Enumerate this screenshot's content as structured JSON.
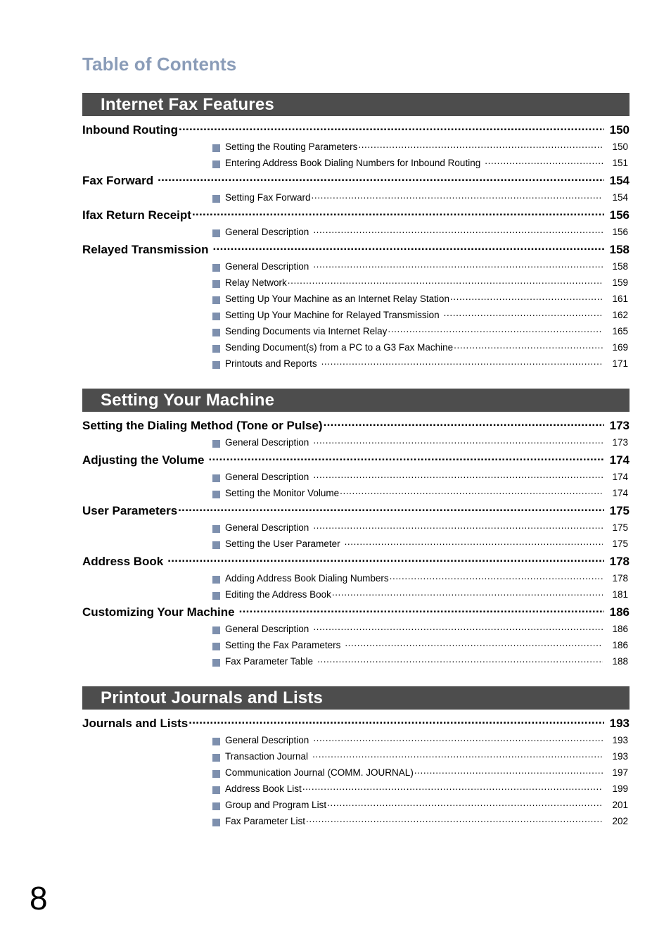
{
  "page": {
    "title": "Table of Contents",
    "folio": "8",
    "colors": {
      "title": "#8a9cb8",
      "banner_bg": "#4d4d4d",
      "banner_text": "#ffffff",
      "bullet": "#7e90ae",
      "text": "#000000",
      "background": "#ffffff"
    }
  },
  "sections": [
    {
      "banner": "Internet Fax Features",
      "entries": [
        {
          "level": 1,
          "label": "Inbound Routing",
          "page": "150",
          "space_before_leader": false
        },
        {
          "level": 2,
          "label": "Setting the Routing Parameters",
          "page": "150",
          "space_before_leader": false
        },
        {
          "level": 2,
          "label": "Entering Address Book Dialing Numbers for Inbound Routing",
          "page": "151",
          "space_before_leader": true
        },
        {
          "level": 1,
          "label": "Fax Forward",
          "page": "154",
          "space_before_leader": true
        },
        {
          "level": 2,
          "label": "Setting Fax Forward",
          "page": "154",
          "space_before_leader": false
        },
        {
          "level": 1,
          "label": "Ifax Return Receipt",
          "page": "156",
          "space_before_leader": false
        },
        {
          "level": 2,
          "label": "General Description",
          "page": "156",
          "space_before_leader": true
        },
        {
          "level": 1,
          "label": "Relayed Transmission",
          "page": "158",
          "space_before_leader": true
        },
        {
          "level": 2,
          "label": "General Description",
          "page": "158",
          "space_before_leader": true
        },
        {
          "level": 2,
          "label": "Relay Network",
          "page": "159",
          "space_before_leader": false
        },
        {
          "level": 2,
          "label": "Setting Up Your Machine as an Internet Relay Station",
          "page": "161",
          "space_before_leader": false
        },
        {
          "level": 2,
          "label": "Setting Up Your Machine for Relayed Transmission",
          "page": "162",
          "space_before_leader": true
        },
        {
          "level": 2,
          "label": "Sending Documents via Internet Relay",
          "page": "165",
          "space_before_leader": false
        },
        {
          "level": 2,
          "label": "Sending Document(s) from a PC to a G3 Fax Machine",
          "page": "169",
          "space_before_leader": false
        },
        {
          "level": 2,
          "label": "Printouts and Reports",
          "page": "171",
          "space_before_leader": true
        }
      ]
    },
    {
      "banner": "Setting Your Machine",
      "entries": [
        {
          "level": 1,
          "label": "Setting the Dialing Method (Tone or Pulse)",
          "page": "173",
          "space_before_leader": false
        },
        {
          "level": 2,
          "label": "General Description",
          "page": "173",
          "space_before_leader": true
        },
        {
          "level": 1,
          "label": "Adjusting the Volume",
          "page": "174",
          "space_before_leader": true
        },
        {
          "level": 2,
          "label": "General Description",
          "page": "174",
          "space_before_leader": true
        },
        {
          "level": 2,
          "label": "Setting the Monitor Volume",
          "page": "174",
          "space_before_leader": false
        },
        {
          "level": 1,
          "label": "User Parameters",
          "page": "175",
          "space_before_leader": false
        },
        {
          "level": 2,
          "label": "General Description",
          "page": "175",
          "space_before_leader": true
        },
        {
          "level": 2,
          "label": "Setting the User Parameter",
          "page": "175",
          "space_before_leader": true
        },
        {
          "level": 1,
          "label": "Address Book",
          "page": "178",
          "space_before_leader": true
        },
        {
          "level": 2,
          "label": "Adding Address Book Dialing Numbers",
          "page": "178",
          "space_before_leader": false
        },
        {
          "level": 2,
          "label": "Editing the Address Book",
          "page": "181",
          "space_before_leader": false
        },
        {
          "level": 1,
          "label": "Customizing Your Machine",
          "page": "186",
          "space_before_leader": true
        },
        {
          "level": 2,
          "label": "General Description",
          "page": "186",
          "space_before_leader": true
        },
        {
          "level": 2,
          "label": "Setting the Fax Parameters",
          "page": "186",
          "space_before_leader": true
        },
        {
          "level": 2,
          "label": "Fax Parameter Table",
          "page": "188",
          "space_before_leader": true
        }
      ]
    },
    {
      "banner": "Printout Journals and Lists",
      "entries": [
        {
          "level": 1,
          "label": "Journals and Lists",
          "page": "193",
          "space_before_leader": false
        },
        {
          "level": 2,
          "label": "General Description",
          "page": "193",
          "space_before_leader": true
        },
        {
          "level": 2,
          "label": "Transaction Journal",
          "page": "193",
          "space_before_leader": true
        },
        {
          "level": 2,
          "label": "Communication Journal  (COMM. JOURNAL)",
          "page": "197",
          "space_before_leader": false
        },
        {
          "level": 2,
          "label": "Address Book List",
          "page": "199",
          "space_before_leader": false
        },
        {
          "level": 2,
          "label": "Group and Program List",
          "page": "201",
          "space_before_leader": false
        },
        {
          "level": 2,
          "label": "Fax Parameter List",
          "page": "202",
          "space_before_leader": false
        }
      ]
    }
  ]
}
